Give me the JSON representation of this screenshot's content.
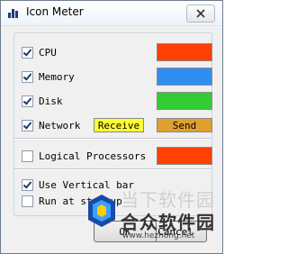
{
  "window": {
    "title": "Icon Meter"
  },
  "options": [
    {
      "label": "CPU",
      "checked": true,
      "color": "#ff4000"
    },
    {
      "label": "Memory",
      "checked": true,
      "color": "#2f8ff0"
    },
    {
      "label": "Disk",
      "checked": true,
      "color": "#33cc33"
    },
    {
      "label": "Network",
      "checked": true
    }
  ],
  "network": {
    "receive_label": "Receive",
    "receive_color": "#ffff33",
    "send_label": "Send",
    "send_color": "#e0a030"
  },
  "logical": {
    "label": "Logical Processors",
    "checked": false,
    "color": "#ff4000"
  },
  "vertical": {
    "label": "Use Vertical bar",
    "checked": true
  },
  "startup": {
    "label": "Run at startup",
    "checked": false
  },
  "buttons": {
    "ok": "OK",
    "cancel": "Cancel"
  },
  "watermark": {
    "line1": "当下软件园",
    "line2": "合众软件园",
    "url": "www.hezhong.net"
  }
}
